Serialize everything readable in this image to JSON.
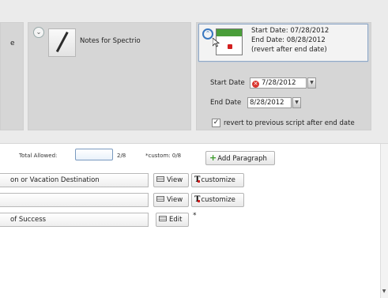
{
  "panels": {
    "notes_title": "Notes for Spectrio",
    "collapse_glyph": "⌃",
    "expand_glyph": "⌄"
  },
  "date_summary": {
    "start_line": "Start Date: 07/28/2012",
    "end_line": "End Date: 08/28/2012",
    "revert_line": "(revert after end date)"
  },
  "date_form": {
    "start_label": "Start Date",
    "start_value": "7/28/2012",
    "end_label": "End Date",
    "end_value": "8/28/2012",
    "revert_label": "revert to previous script after end date",
    "revert_checked": "✓"
  },
  "paragraph_bar": {
    "total_allowed_label": "Total Allowed:",
    "count": "2/8",
    "custom": "*custom: 0/8",
    "add_button": "Add Paragraph"
  },
  "rows": [
    {
      "title": "on or Vacation Destination",
      "action": "View",
      "customize": "customize"
    },
    {
      "title": "",
      "action": "View",
      "customize": "customize"
    },
    {
      "title": "of Success",
      "action": "Edit",
      "note": "*"
    }
  ],
  "icons": {
    "left_panel_edge": "e",
    "clear": "✕",
    "dropdown": "▼",
    "plus": "+",
    "scroll_down": "▼"
  },
  "colors": {
    "accent_blue": "#3a78c0",
    "calendar_green": "#4a9e3a",
    "clear_red": "#d9352e",
    "add_green": "#3a9a2a"
  }
}
